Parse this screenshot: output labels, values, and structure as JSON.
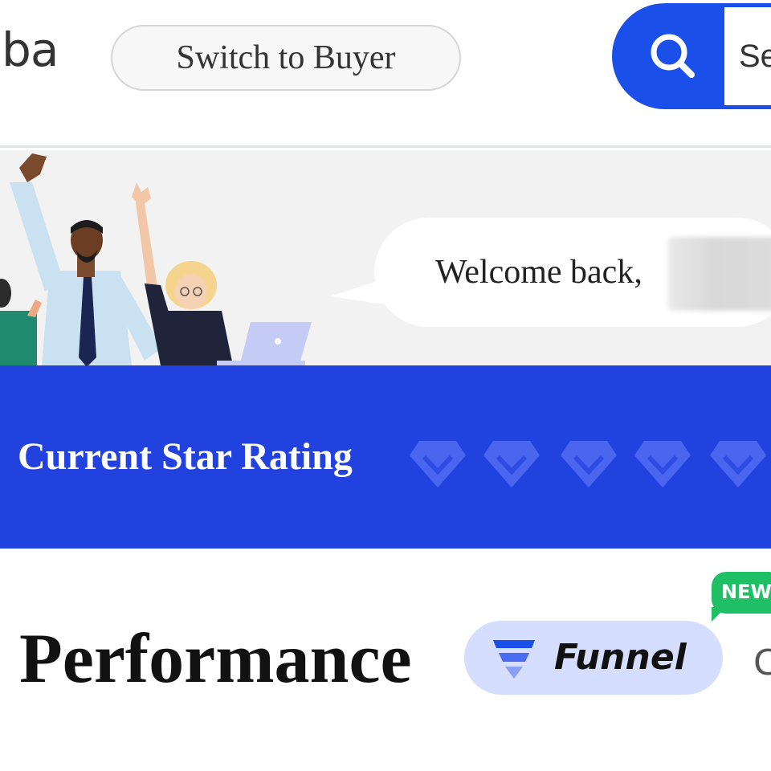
{
  "header": {
    "logo_text": "ba",
    "switch_button_label": "Switch to Buyer",
    "search_placeholder": "Se"
  },
  "banner": {
    "welcome_text": "Welcome back,"
  },
  "rating": {
    "label": "Current Star Rating",
    "stars_filled": 0,
    "stars_total": 5
  },
  "performance": {
    "title": "Performance",
    "funnel_label": "Funnel",
    "new_badge": "NEW",
    "partial_next": "C"
  },
  "colors": {
    "brand_blue": "#1a4fea",
    "rating_band": "#2242e0",
    "new_badge": "#1fbf65",
    "funnel_chip": "#d6deff"
  }
}
